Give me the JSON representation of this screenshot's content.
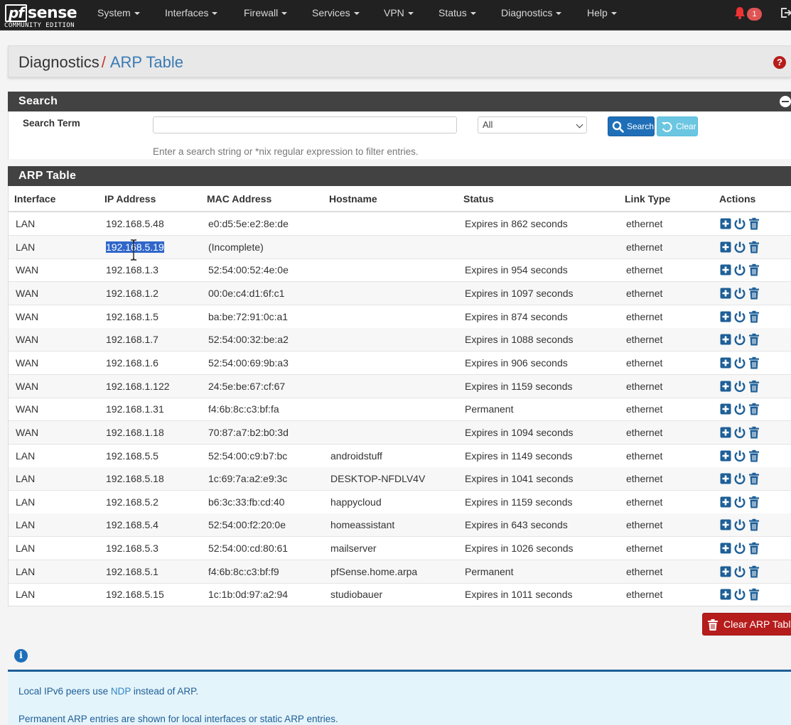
{
  "brand": {
    "name_pf": "pf",
    "name_sense": "sense",
    "edition": "COMMUNITY EDITION"
  },
  "nav": [
    {
      "label": "System"
    },
    {
      "label": "Interfaces"
    },
    {
      "label": "Firewall"
    },
    {
      "label": "Services"
    },
    {
      "label": "VPN"
    },
    {
      "label": "Status"
    },
    {
      "label": "Diagnostics"
    },
    {
      "label": "Help"
    }
  ],
  "notifications": {
    "count": "1"
  },
  "breadcrumb": {
    "parent": "Diagnostics",
    "separator": "/",
    "current": "ARP Table"
  },
  "search_panel": {
    "title": "Search",
    "label": "Search Term",
    "input_value": "",
    "select_value": "All",
    "search_button": "Search",
    "clear_button": "Clear",
    "help_text": "Enter a search string or *nix regular expression to filter entries."
  },
  "arp_panel": {
    "title": "ARP Table",
    "columns": [
      "Interface",
      "IP Address",
      "MAC Address",
      "Hostname",
      "Status",
      "Link Type",
      "Actions"
    ],
    "rows": [
      {
        "interface": "LAN",
        "ip": "192.168.5.48",
        "mac": "e0:d5:5e:e2:8e:de",
        "hostname": "",
        "status": "Expires in 862 seconds",
        "link": "ethernet"
      },
      {
        "interface": "LAN",
        "ip": "192.168.5.19",
        "mac": "(Incomplete)",
        "hostname": "",
        "status": "",
        "link": "ethernet"
      },
      {
        "interface": "WAN",
        "ip": "192.168.1.3",
        "mac": "52:54:00:52:4e:0e",
        "hostname": "",
        "status": "Expires in 954 seconds",
        "link": "ethernet"
      },
      {
        "interface": "WAN",
        "ip": "192.168.1.2",
        "mac": "00:0e:c4:d1:6f:c1",
        "hostname": "",
        "status": "Expires in 1097 seconds",
        "link": "ethernet"
      },
      {
        "interface": "WAN",
        "ip": "192.168.1.5",
        "mac": "ba:be:72:91:0c:a1",
        "hostname": "",
        "status": "Expires in 874 seconds",
        "link": "ethernet"
      },
      {
        "interface": "WAN",
        "ip": "192.168.1.7",
        "mac": "52:54:00:32:be:a2",
        "hostname": "",
        "status": "Expires in 1088 seconds",
        "link": "ethernet"
      },
      {
        "interface": "WAN",
        "ip": "192.168.1.6",
        "mac": "52:54:00:69:9b:a3",
        "hostname": "",
        "status": "Expires in 906 seconds",
        "link": "ethernet"
      },
      {
        "interface": "WAN",
        "ip": "192.168.1.122",
        "mac": "24:5e:be:67:cf:67",
        "hostname": "",
        "status": "Expires in 1159 seconds",
        "link": "ethernet"
      },
      {
        "interface": "WAN",
        "ip": "192.168.1.31",
        "mac": "f4:6b:8c:c3:bf:fa",
        "hostname": "",
        "status": "Permanent",
        "link": "ethernet"
      },
      {
        "interface": "WAN",
        "ip": "192.168.1.18",
        "mac": "70:87:a7:b2:b0:3d",
        "hostname": "",
        "status": "Expires in 1094 seconds",
        "link": "ethernet"
      },
      {
        "interface": "LAN",
        "ip": "192.168.5.5",
        "mac": "52:54:00:c9:b7:bc",
        "hostname": "androidstuff",
        "status": "Expires in 1149 seconds",
        "link": "ethernet"
      },
      {
        "interface": "LAN",
        "ip": "192.168.5.18",
        "mac": "1c:69:7a:a2:e9:3c",
        "hostname": "DESKTOP-NFDLV4V",
        "status": "Expires in 1041 seconds",
        "link": "ethernet"
      },
      {
        "interface": "LAN",
        "ip": "192.168.5.2",
        "mac": "b6:3c:33:fb:cd:40",
        "hostname": "happycloud",
        "status": "Expires in 1159 seconds",
        "link": "ethernet"
      },
      {
        "interface": "LAN",
        "ip": "192.168.5.4",
        "mac": "52:54:00:f2:20:0e",
        "hostname": "homeassistant",
        "status": "Expires in 643 seconds",
        "link": "ethernet"
      },
      {
        "interface": "LAN",
        "ip": "192.168.5.3",
        "mac": "52:54:00:cd:80:61",
        "hostname": "mailserver",
        "status": "Expires in 1026 seconds",
        "link": "ethernet"
      },
      {
        "interface": "LAN",
        "ip": "192.168.5.1",
        "mac": "f4:6b:8c:c3:bf:f9",
        "hostname": "pfSense.home.arpa",
        "status": "Permanent",
        "link": "ethernet"
      },
      {
        "interface": "LAN",
        "ip": "192.168.5.15",
        "mac": "1c:1b:0d:97:a2:94",
        "hostname": "studiobauer",
        "status": "Expires in 1011 seconds",
        "link": "ethernet"
      }
    ],
    "clear_button": "Clear ARP Table"
  },
  "info": {
    "line1_before": "Local IPv6 peers use ",
    "line1_link": "NDP",
    "line1_after": " instead of ARP.",
    "line2": "Permanent ARP entries are shown for local interfaces or static ARP entries."
  },
  "colors": {
    "navbar": "#212121",
    "accent_red": "#b71c1c",
    "primary_blue": "#1e6fb8",
    "link_blue": "#3a7ab3",
    "panel_heading": "#424242"
  }
}
